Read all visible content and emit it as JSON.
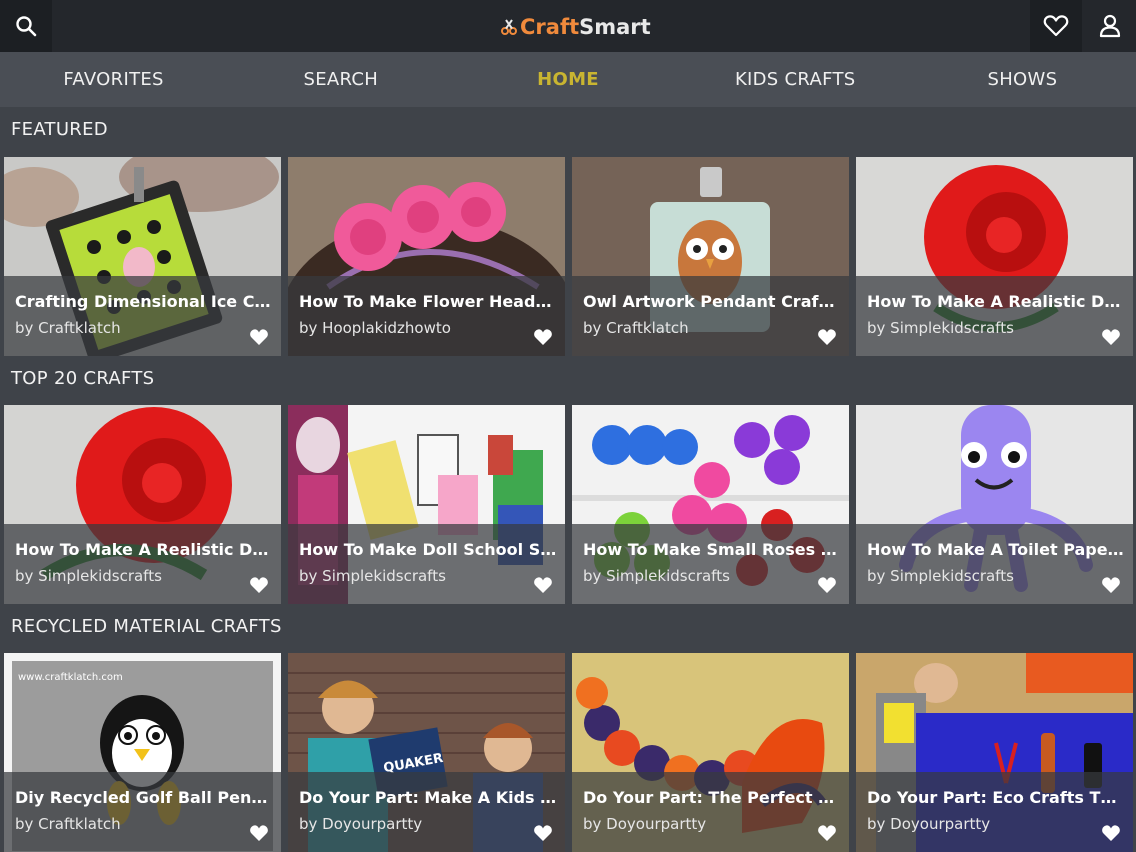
{
  "app": {
    "logo_prefix": "Craft",
    "logo_suffix": "Smart",
    "brand_color": "#f08a3c",
    "icons": [
      "search-icon",
      "heart-icon",
      "user-icon"
    ]
  },
  "nav": {
    "tabs": [
      {
        "label": "FAVORITES",
        "active": false
      },
      {
        "label": "SEARCH",
        "active": false
      },
      {
        "label": "HOME",
        "active": true
      },
      {
        "label": "KIDS CRAFTS",
        "active": false
      },
      {
        "label": "SHOWS",
        "active": false
      }
    ],
    "active_color": "#c9b531"
  },
  "sections": [
    {
      "title": "FEATURED",
      "cards": [
        {
          "title": "Crafting Dimensional Ice Crea...",
          "author": "by Craftklatch"
        },
        {
          "title": "How To Make Flower Headba...",
          "author": "by Hooplakidzhowto"
        },
        {
          "title": "Owl Artwork Pendant Craft T...",
          "author": "by Craftklatch"
        },
        {
          "title": "How To Make A Realistic Duct...",
          "author": "by Simplekidscrafts"
        }
      ]
    },
    {
      "title": "TOP 20 CRAFTS",
      "cards": [
        {
          "title": "How To Make A Realistic Duct...",
          "author": "by Simplekidscrafts"
        },
        {
          "title": "How To Make Doll School Sup...",
          "author": "by Simplekidscrafts"
        },
        {
          "title": "How To Make Small Roses Wi...",
          "author": "by Simplekidscrafts"
        },
        {
          "title": "How To Make A Toilet Paper T...",
          "author": "by Simplekidscrafts"
        }
      ]
    },
    {
      "title": "RECYCLED MATERIAL CRAFTS",
      "cards": [
        {
          "title": "Diy Recycled Golf Ball Penguin",
          "author": "by Craftklatch"
        },
        {
          "title": "Do Your Part: Make A Kids Or...",
          "author": "by Doyourpartty"
        },
        {
          "title": "Do Your Part: The Perfect Diy...",
          "author": "by Doyourpartty"
        },
        {
          "title": "Do Your Part: Eco Crafts That...",
          "author": "by Doyourpartty"
        }
      ]
    }
  ],
  "thumbnail_watermark": "www.craftklatch.com",
  "thumbnail_box_text": "QUAKER"
}
